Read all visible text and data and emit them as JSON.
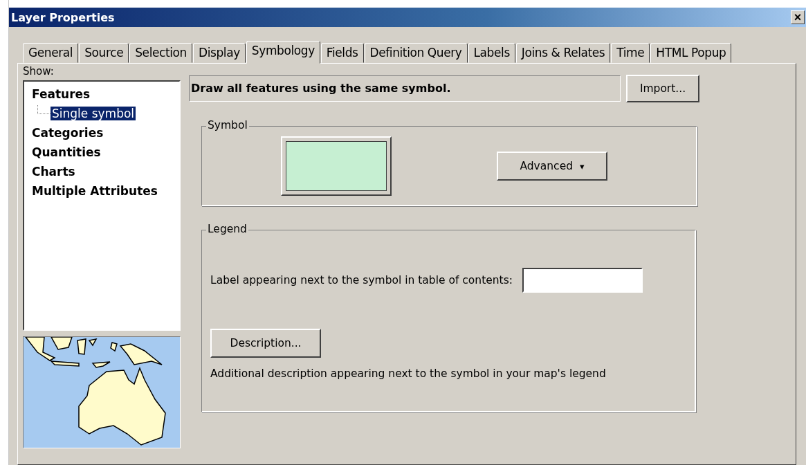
{
  "window": {
    "title": "Layer Properties",
    "close": "×"
  },
  "tabs": [
    {
      "label": "General",
      "selected": false
    },
    {
      "label": "Source",
      "selected": false
    },
    {
      "label": "Selection",
      "selected": false
    },
    {
      "label": "Display",
      "selected": false
    },
    {
      "label": "Symbology",
      "selected": true
    },
    {
      "label": "Fields",
      "selected": false
    },
    {
      "label": "Definition Query",
      "selected": false
    },
    {
      "label": "Labels",
      "selected": false
    },
    {
      "label": "Joins & Relates",
      "selected": false
    },
    {
      "label": "Time",
      "selected": false
    },
    {
      "label": "HTML Popup",
      "selected": false
    }
  ],
  "show": {
    "label": "Show:",
    "items": [
      {
        "label": "Features",
        "selected": false,
        "children": [
          {
            "label": "Single symbol",
            "selected": true
          }
        ]
      },
      {
        "label": "Categories",
        "selected": false
      },
      {
        "label": "Quantities",
        "selected": false
      },
      {
        "label": "Charts",
        "selected": false
      },
      {
        "label": "Multiple Attributes",
        "selected": false
      }
    ]
  },
  "description_header": "Draw all features using the same symbol.",
  "import_button": "Import...",
  "symbol_group": {
    "title": "Symbol",
    "advanced_button": "Advanced",
    "advanced_caret": "▾"
  },
  "legend_group": {
    "title": "Legend",
    "label_prompt": "Label appearing next to the symbol in table of contents:",
    "description_button": "Description...",
    "description_note": "Additional description appearing next to the symbol in your map's legend"
  }
}
